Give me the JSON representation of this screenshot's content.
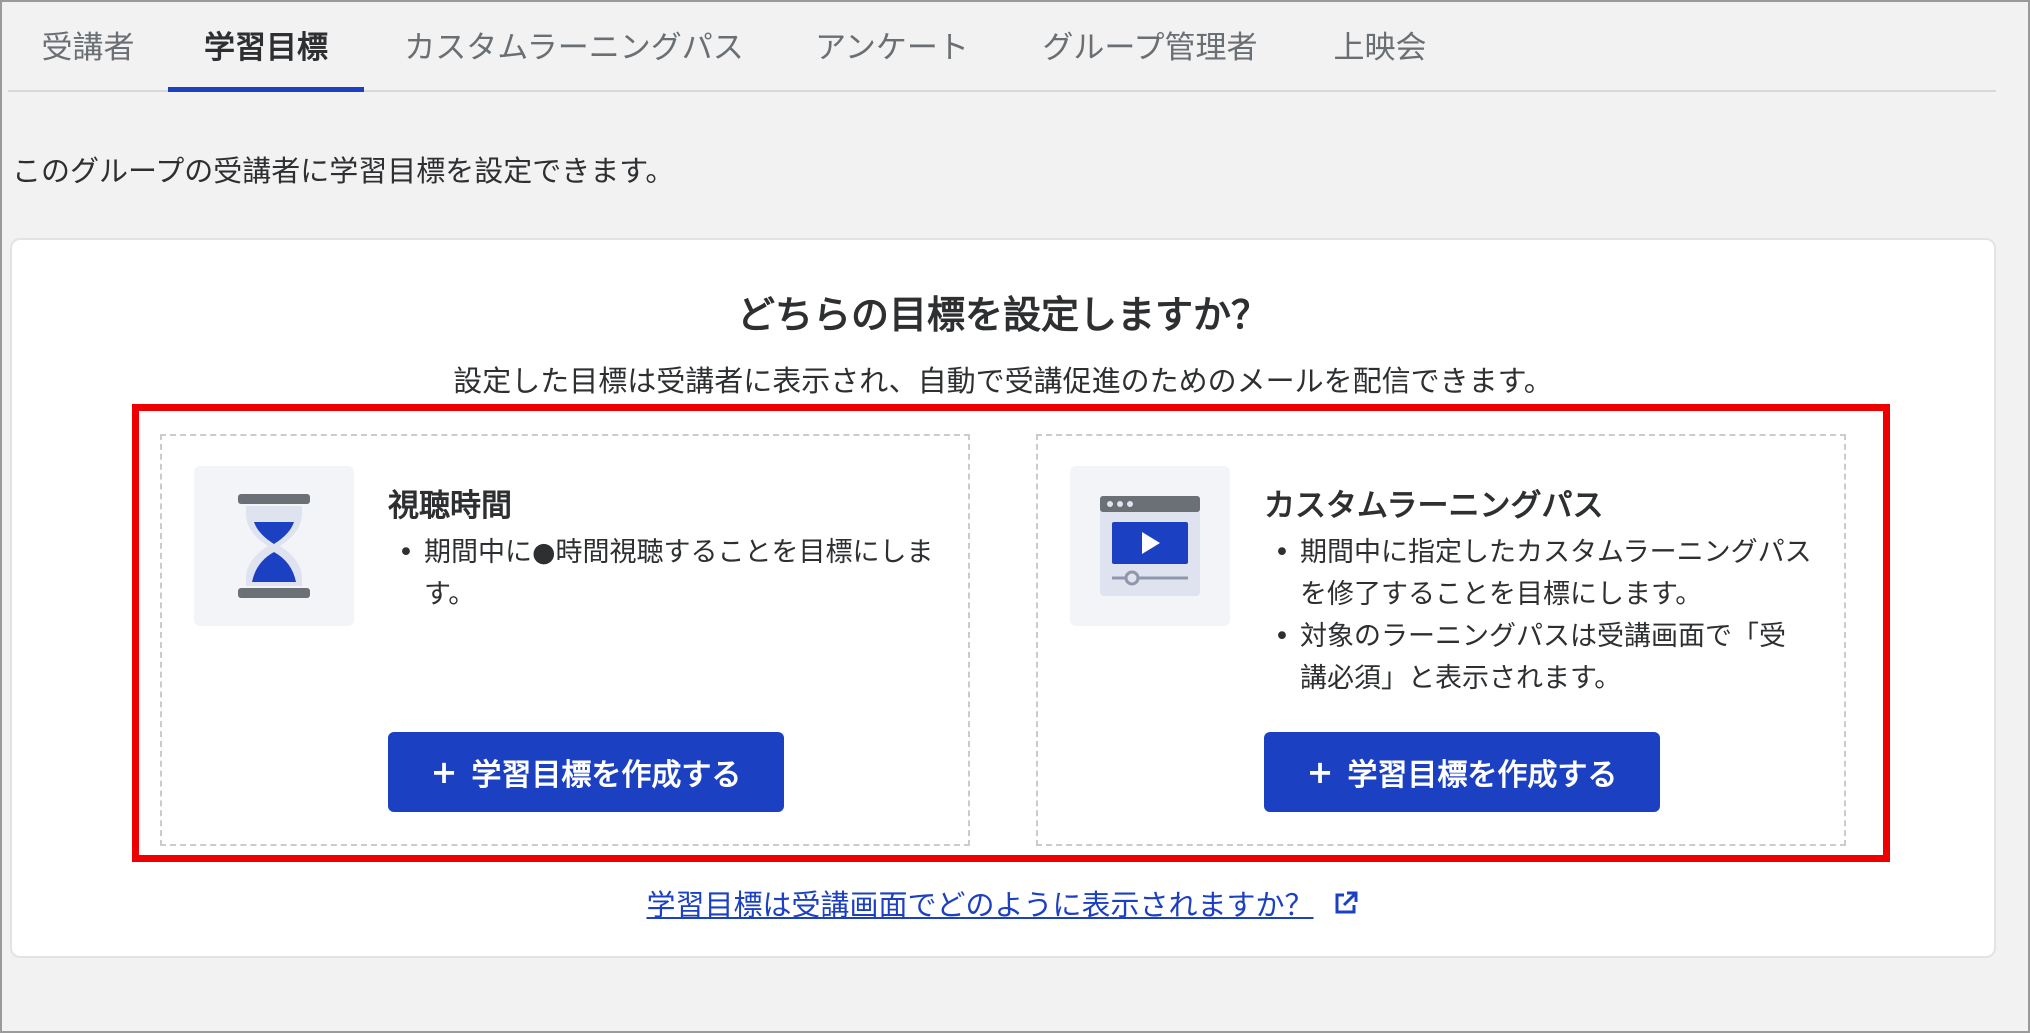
{
  "tabs": [
    {
      "label": "受講者",
      "active": false
    },
    {
      "label": "学習目標",
      "active": true
    },
    {
      "label": "カスタムラーニングパス",
      "active": false
    },
    {
      "label": "アンケート",
      "active": false
    },
    {
      "label": "グループ管理者",
      "active": false
    },
    {
      "label": "上映会",
      "active": false
    }
  ],
  "intro_text": "このグループの受講者に学習目標を設定できます。",
  "panel": {
    "heading": "どちらの目標を設定しますか？",
    "subheading": "設定した目標は受講者に表示され、自動で受講促進のためのメールを配信できます。",
    "cards": [
      {
        "icon": "hourglass-icon",
        "title": "視聴時間",
        "bullets": [
          "期間中に●時間視聴することを目標にします。"
        ],
        "button_label": "学習目標を作成する",
        "button_icon": "+"
      },
      {
        "icon": "video-player-icon",
        "title": "カスタムラーニングパス",
        "bullets": [
          "期間中に指定したカスタムラーニングパスを修了することを目標にします。",
          "対象のラーニングパスは受講画面で「受講必須」と表示されます。"
        ],
        "button_label": "学習目標を作成する",
        "button_icon": "+"
      }
    ],
    "help_link": "学習目標は受講画面でどのように表示されますか？",
    "help_link_icon": "external-link-icon"
  },
  "colors": {
    "accent": "#1c40c2",
    "highlight_border": "#ee0000",
    "icon_box_bg": "#f3f4f8"
  }
}
